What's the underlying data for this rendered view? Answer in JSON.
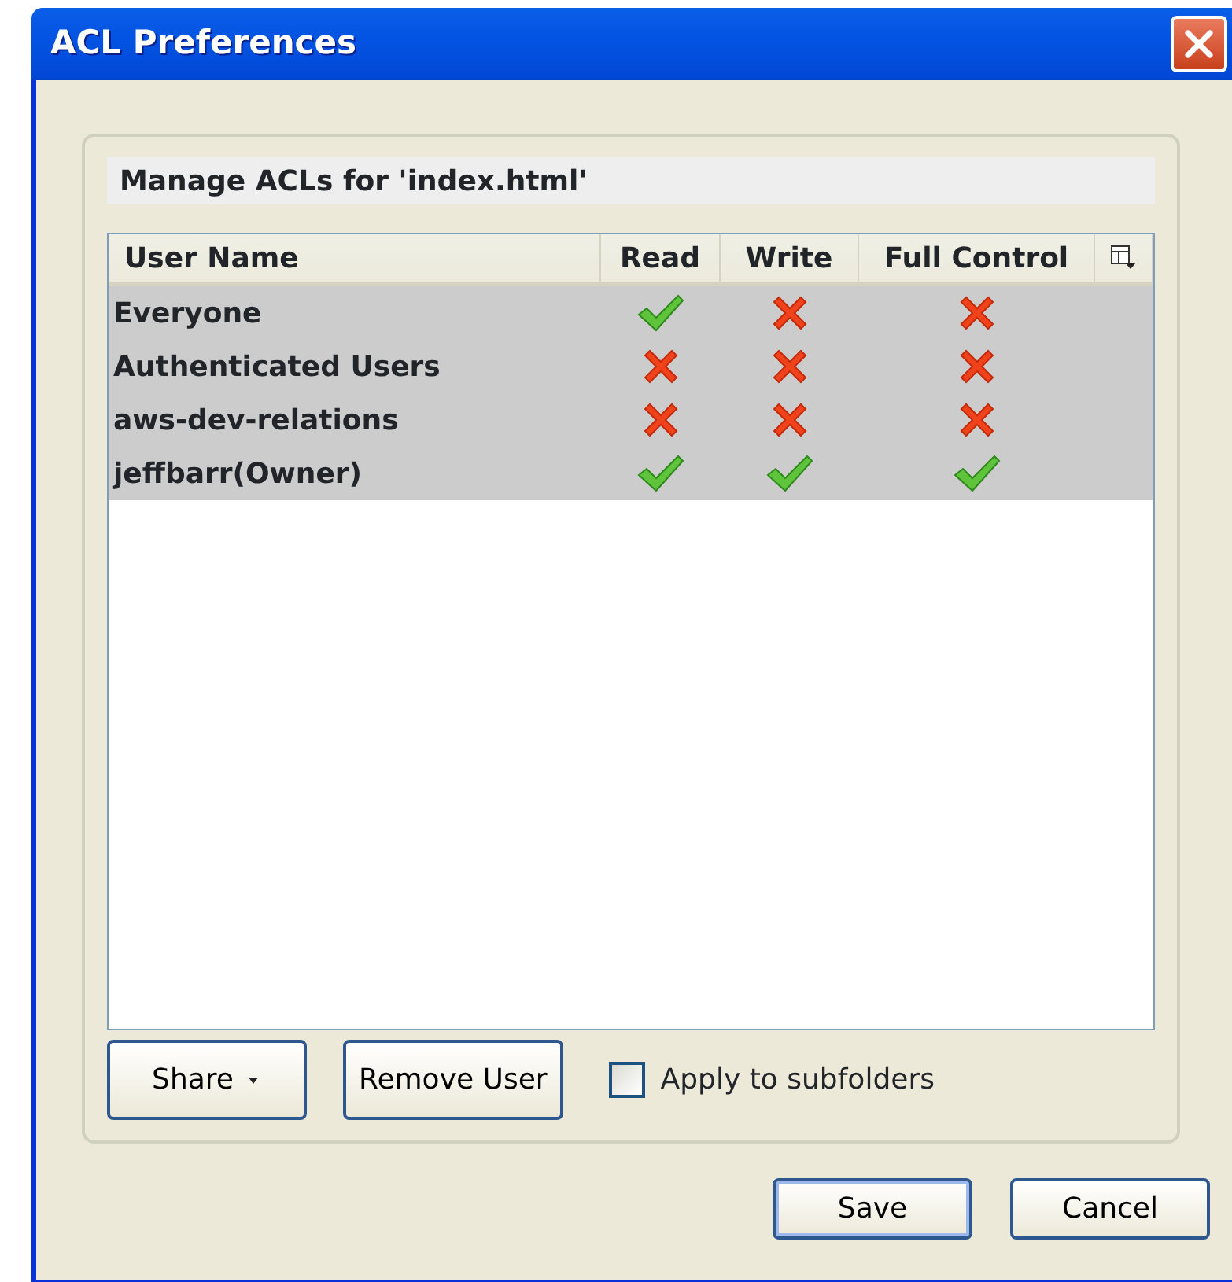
{
  "window": {
    "title": "ACL Preferences"
  },
  "heading": "Manage ACLs for 'index.html'",
  "table": {
    "columns": [
      "User Name",
      "Read",
      "Write",
      "Full Control"
    ],
    "rows": [
      {
        "user": "Everyone",
        "read": true,
        "write": false,
        "full_control": false,
        "selected": true
      },
      {
        "user": "Authenticated Users",
        "read": false,
        "write": false,
        "full_control": false,
        "selected": true
      },
      {
        "user": "aws-dev-relations",
        "read": false,
        "write": false,
        "full_control": false,
        "selected": true
      },
      {
        "user": "jeffbarr(Owner)",
        "read": true,
        "write": true,
        "full_control": true,
        "selected": true
      }
    ]
  },
  "share_button": "Share",
  "remove_button": "Remove User",
  "apply_subfolders": {
    "label": "Apply to subfolders",
    "checked": false
  },
  "buttons": [
    {
      "label": "Save",
      "default": true
    },
    {
      "label": "Cancel",
      "default": false
    }
  ]
}
